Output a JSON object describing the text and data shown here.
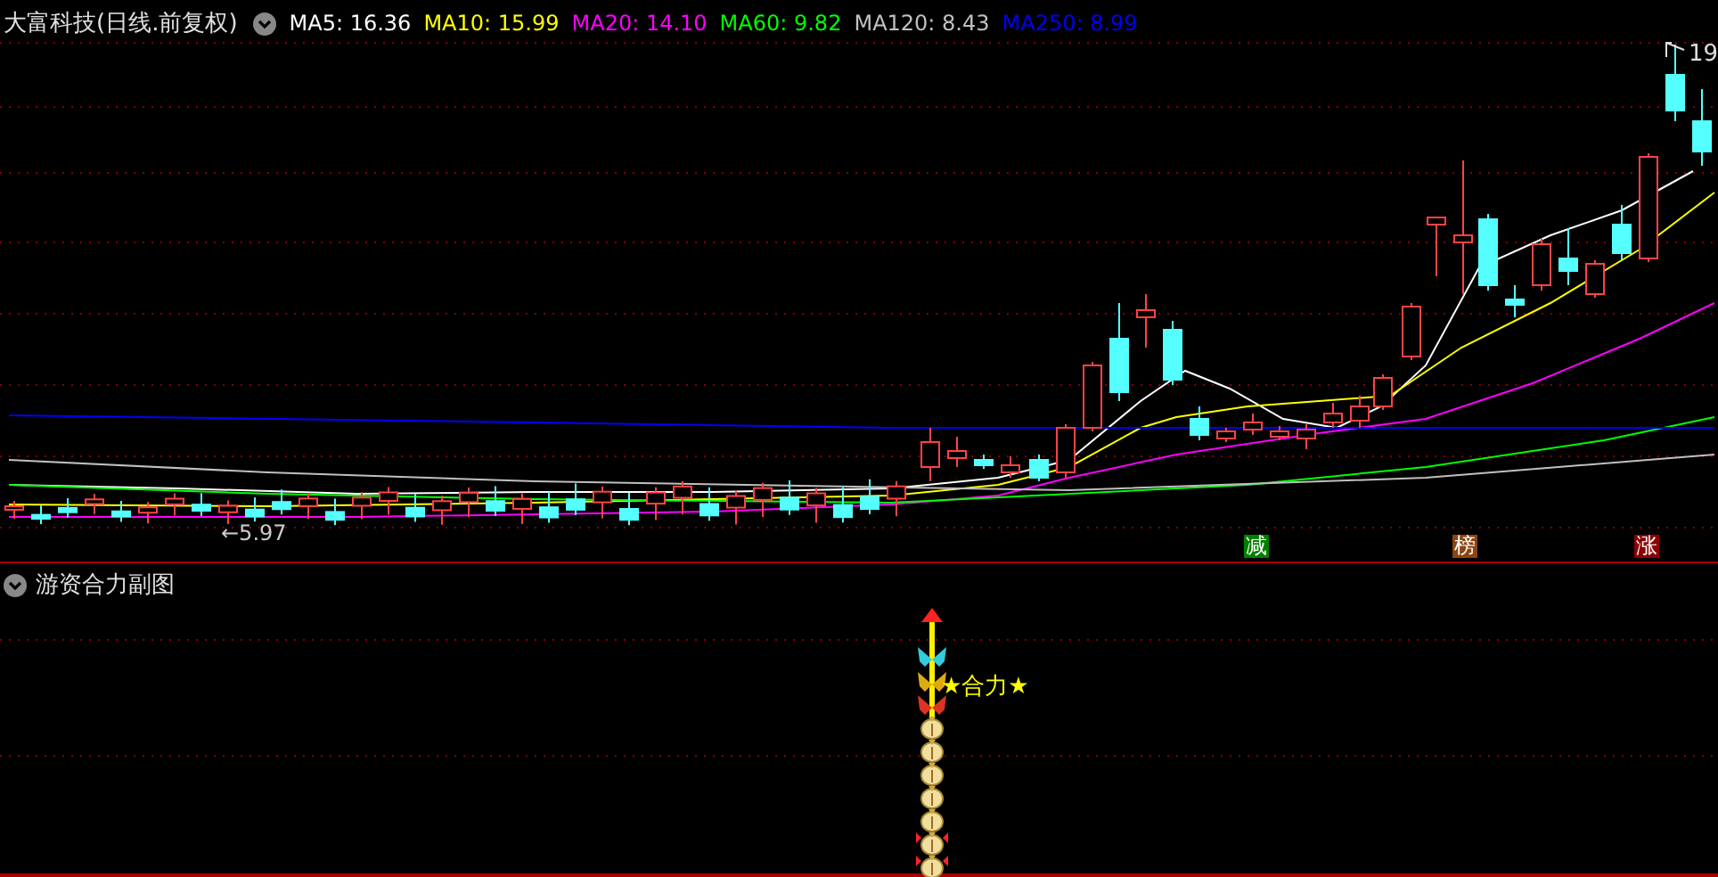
{
  "chart_title": "大富科技(日线.前复权)",
  "ma_legend": [
    {
      "label": "MA5: 16.36",
      "color": "#ffffff"
    },
    {
      "label": "MA10: 15.99",
      "color": "#ffff00"
    },
    {
      "label": "MA20: 14.10",
      "color": "#ff00ff"
    },
    {
      "label": "MA60: 9.82",
      "color": "#00ff00"
    },
    {
      "label": "MA120: 8.43",
      "color": "#c0c0c0"
    },
    {
      "label": "MA250: 8.99",
      "color": "#0000ff"
    }
  ],
  "high_label": "19",
  "low_label": "←5.97",
  "signals": [
    {
      "text": "减",
      "color": "#008000"
    },
    {
      "text": "榜",
      "color": "#8b4513"
    },
    {
      "text": "涨",
      "color": "#8b0000"
    }
  ],
  "sub_chart": {
    "title": "游资合力副图",
    "label": "★合力★"
  }
}
